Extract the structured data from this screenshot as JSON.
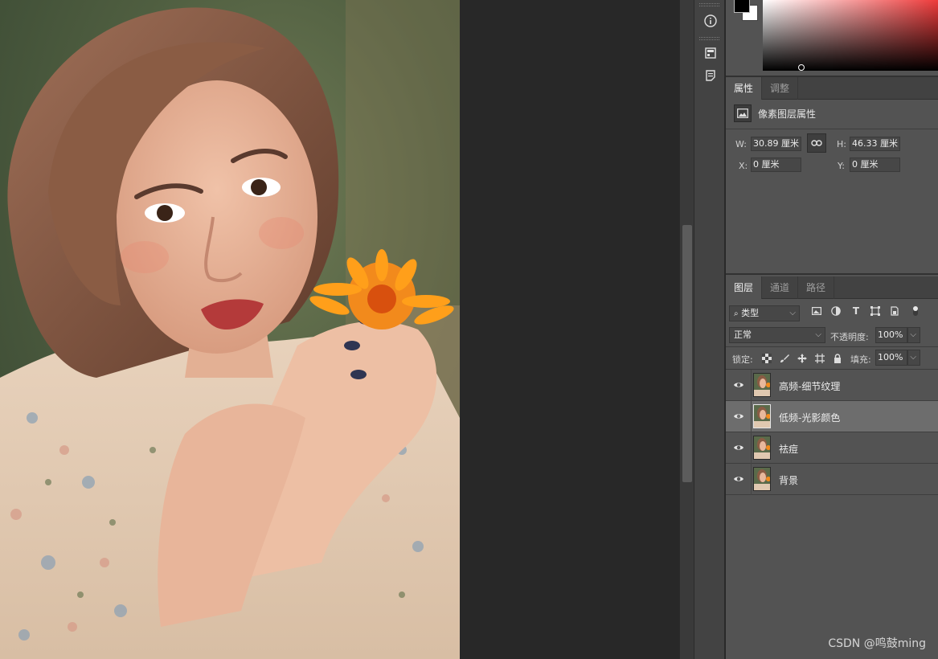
{
  "colors": {
    "foreground": "#000000",
    "background": "#ffffff",
    "picker_hue": "#ee3b3b"
  },
  "properties_panel": {
    "tabs": [
      {
        "label": "属性",
        "active": true
      },
      {
        "label": "调整",
        "active": false
      }
    ],
    "title": "像素图层属性",
    "title_icon": "image-icon",
    "w_label": "W:",
    "w_value": "30.89 厘米",
    "h_label": "H:",
    "h_value": "46.33 厘米",
    "x_label": "X:",
    "x_value": "0 厘米",
    "y_label": "Y:",
    "y_value": "0 厘米",
    "link_icon": "link-icon"
  },
  "layers_panel": {
    "tabs": [
      {
        "label": "图层",
        "active": true
      },
      {
        "label": "通道",
        "active": false
      },
      {
        "label": "路径",
        "active": false
      }
    ],
    "filter_kind": "类型",
    "filter_icons": [
      "image-filter-icon",
      "adjustment-filter-icon",
      "type-filter-icon",
      "shape-filter-icon",
      "smart-object-filter-icon",
      "filter-toggle-icon"
    ],
    "blend_mode": "正常",
    "opacity_label": "不透明度:",
    "opacity_value": "100%",
    "lock_label": "锁定:",
    "lock_icons": [
      "lock-transparent-icon",
      "lock-brush-icon",
      "lock-move-icon",
      "lock-artboard-icon",
      "lock-all-icon"
    ],
    "fill_label": "填充:",
    "fill_value": "100%",
    "layers": [
      {
        "name": "高频-细节纹理",
        "visible": true,
        "selected": false
      },
      {
        "name": "低频-光影颜色",
        "visible": true,
        "selected": true
      },
      {
        "name": "祛痘",
        "visible": true,
        "selected": false
      },
      {
        "name": "背景",
        "visible": true,
        "selected": false
      }
    ]
  },
  "icon_strip": [
    "info-icon",
    "libraries-icon",
    "notes-icon"
  ],
  "watermark": "CSDN @鸣鼓ming"
}
